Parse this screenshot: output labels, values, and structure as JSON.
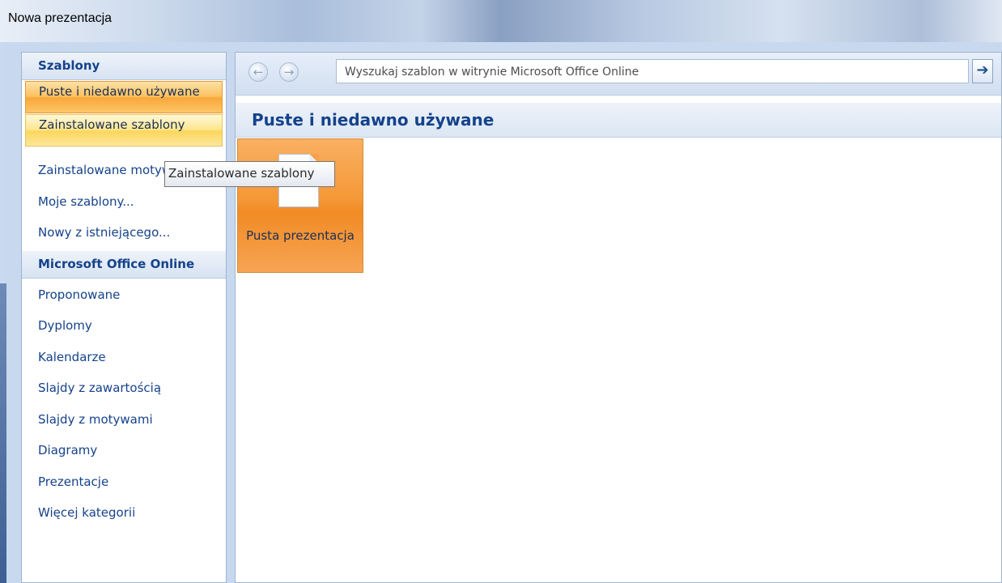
{
  "window": {
    "title": "Nowa prezentacja"
  },
  "sidebar": {
    "templates_header": "Szablony",
    "templates_items": [
      {
        "label": "Puste i niedawno używane",
        "state": "selected"
      },
      {
        "label": "Zainstalowane szablony",
        "state": "hover"
      },
      {
        "label": "Zainstalowane motywy",
        "state": "normal"
      },
      {
        "label": "Moje szablony...",
        "state": "normal"
      },
      {
        "label": "Nowy z istniejącego...",
        "state": "normal"
      }
    ],
    "online_header": "Microsoft Office Online",
    "online_items": [
      "Proponowane",
      "Dyplomy",
      "Kalendarze",
      "Slajdy z zawartością",
      "Slajdy z motywami",
      "Diagramy",
      "Prezentacje",
      "Więcej kategorii"
    ]
  },
  "nav": {
    "back_icon": "arrow-left-icon",
    "forward_icon": "arrow-right-icon",
    "back_glyph": "←",
    "forward_glyph": "→",
    "search_placeholder": "Wyszukaj szablon w witrynie Microsoft Office Online",
    "go_glyph": "➔"
  },
  "content": {
    "header": "Puste i niedawno używane",
    "tiles": [
      {
        "label": "Pusta prezentacja"
      }
    ]
  },
  "tooltip": {
    "text": "Zainstalowane szablony"
  },
  "colors": {
    "accent_text": "#15428b",
    "selected_orange": "#f9a83a",
    "hover_yellow": "#fcd65c"
  }
}
